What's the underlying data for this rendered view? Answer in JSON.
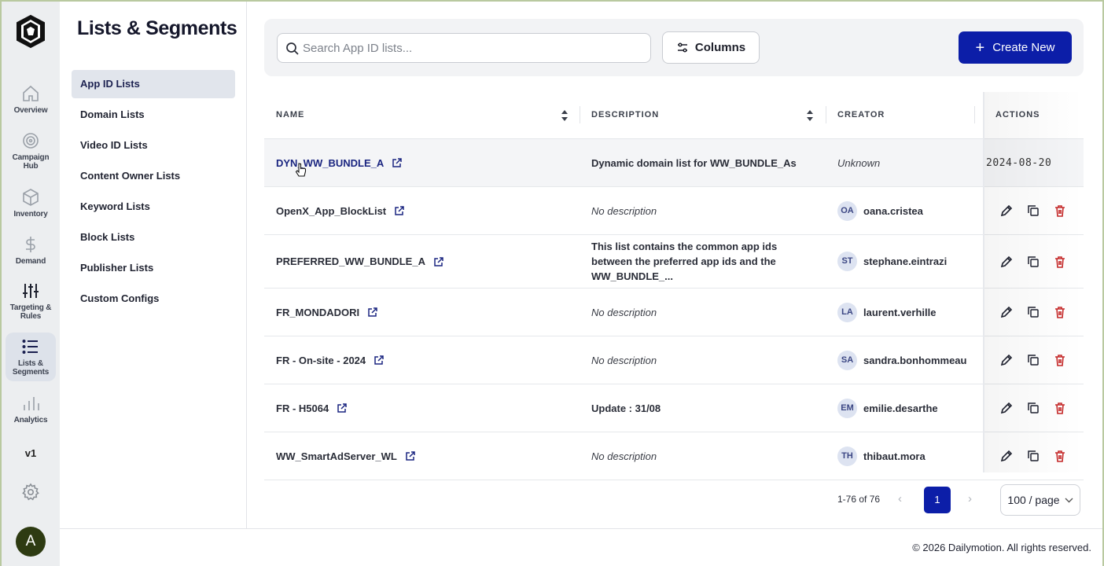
{
  "rail": {
    "items": [
      {
        "label": "Overview",
        "icon": "home-icon"
      },
      {
        "label": "Campaign Hub",
        "icon": "target-icon"
      },
      {
        "label": "Inventory",
        "icon": "cube-icon"
      },
      {
        "label": "Demand",
        "icon": "dollar-icon"
      },
      {
        "label": "Targeting & Rules",
        "icon": "sliders-icon"
      },
      {
        "label": "Lists & Segments",
        "icon": "list-icon",
        "active": true
      },
      {
        "label": "Analytics",
        "icon": "bar-chart-icon"
      }
    ],
    "version": "v1",
    "user_initial": "A"
  },
  "section": {
    "title": "Lists & Segments",
    "items": [
      {
        "label": "App ID Lists",
        "active": true
      },
      {
        "label": "Domain Lists"
      },
      {
        "label": "Video ID Lists"
      },
      {
        "label": "Content Owner Lists"
      },
      {
        "label": "Keyword Lists"
      },
      {
        "label": "Block Lists"
      },
      {
        "label": "Publisher Lists"
      },
      {
        "label": "Custom Configs"
      }
    ]
  },
  "toolbar": {
    "search_placeholder": "Search App ID lists...",
    "columns_label": "Columns",
    "create_label": "Create New"
  },
  "table": {
    "headers": {
      "name": "NAME",
      "description": "DESCRIPTION",
      "creator": "CREATOR",
      "actions": "ACTIONS"
    },
    "rows": [
      {
        "name": "DYN_WW_BUNDLE_A",
        "description": "Dynamic domain list for WW_BUNDLE_As",
        "creator": "Unknown",
        "initials": "",
        "date": "2024-08-20"
      },
      {
        "name": "OpenX_App_BlockList",
        "description": "No description",
        "creator": "oana.cristea",
        "initials": "OA"
      },
      {
        "name": "PREFERRED_WW_BUNDLE_A",
        "description": "This list contains the common app ids between the preferred app ids and the WW_BUNDLE_...",
        "creator": "stephane.eintrazi",
        "initials": "ST"
      },
      {
        "name": "FR_MONDADORI",
        "description": "No description",
        "creator": "laurent.verhille",
        "initials": "LA"
      },
      {
        "name": "FR - On-site - 2024",
        "description": "No description",
        "creator": "sandra.bonhommeau",
        "initials": "SA"
      },
      {
        "name": "FR - H5064",
        "description": "Update : 31/08",
        "creator": "emilie.desarthe",
        "initials": "EM"
      },
      {
        "name": "WW_SmartAdServer_WL",
        "description": "No description",
        "creator": "thibaut.mora",
        "initials": "TH"
      }
    ]
  },
  "pagination": {
    "range": "1-76 of 76",
    "current_page": "1",
    "prev": "‹",
    "next": "›",
    "page_size": "100 / page"
  },
  "footer": {
    "copyright": "© 2026 Dailymotion. All rights reserved."
  },
  "colors": {
    "primary": "#0c1ea8",
    "rail_bg": "#eceef0",
    "delete": "#c62828"
  }
}
